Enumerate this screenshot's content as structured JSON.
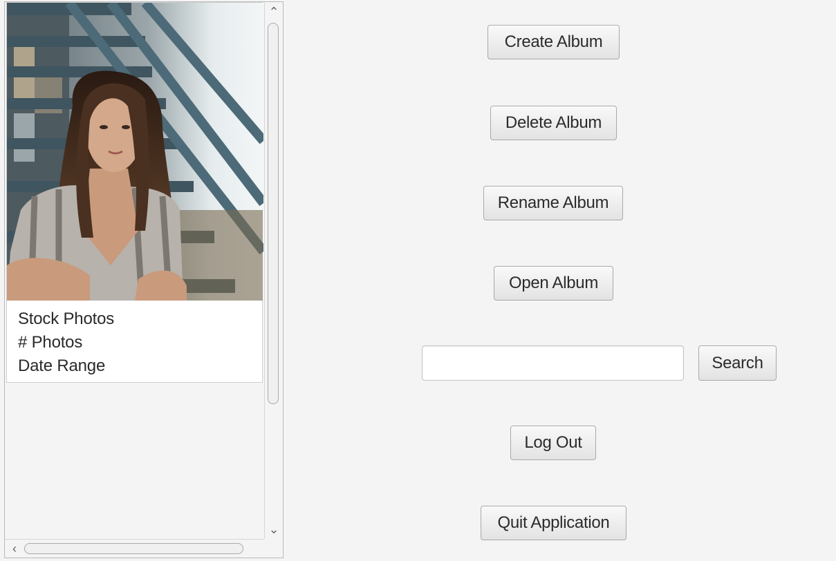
{
  "albums": [
    {
      "name": "Stock Photos",
      "photo_count": "# Photos",
      "date_range": "Date Range"
    }
  ],
  "controls": {
    "create_label": "Create Album",
    "delete_label": "Delete Album",
    "rename_label": "Rename Album",
    "open_label": "Open Album",
    "search_value": "",
    "search_label": "Search",
    "logout_label": "Log Out",
    "quit_label": "Quit Application"
  },
  "icons": {
    "scroll_up": "scroll-up-arrow-icon",
    "scroll_down": "scroll-down-arrow-icon",
    "scroll_left": "scroll-left-arrow-icon",
    "scroll_right": "scroll-right-arrow-icon"
  },
  "colors": {
    "window_bg": "#f4f4f4",
    "button_border": "#a8a8a8",
    "text": "#2b2b2b"
  }
}
